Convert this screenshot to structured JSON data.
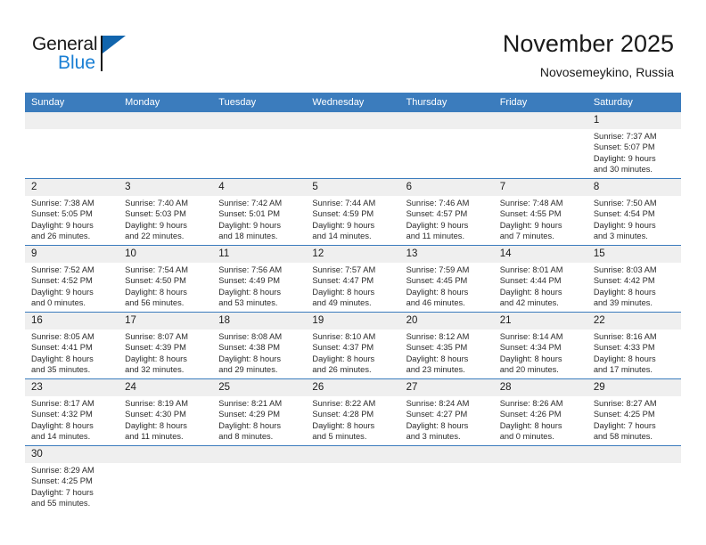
{
  "brand": {
    "name_top": "General",
    "name_bottom": "Blue",
    "accent_color": "#1a7fd4",
    "flag_color": "#1165ad"
  },
  "header": {
    "title": "November 2025",
    "subtitle": "Novosemeykino, Russia"
  },
  "theme": {
    "header_blue": "#3b7cbd",
    "row_band_gray": "#efefef",
    "divider_blue": "#3b7cbd"
  },
  "weekdays": [
    "Sunday",
    "Monday",
    "Tuesday",
    "Wednesday",
    "Thursday",
    "Friday",
    "Saturday"
  ],
  "weeks": [
    [
      {
        "day": "",
        "lines": []
      },
      {
        "day": "",
        "lines": []
      },
      {
        "day": "",
        "lines": []
      },
      {
        "day": "",
        "lines": []
      },
      {
        "day": "",
        "lines": []
      },
      {
        "day": "",
        "lines": []
      },
      {
        "day": "1",
        "lines": [
          "Sunrise: 7:37 AM",
          "Sunset: 5:07 PM",
          "Daylight: 9 hours",
          "and 30 minutes."
        ]
      }
    ],
    [
      {
        "day": "2",
        "lines": [
          "Sunrise: 7:38 AM",
          "Sunset: 5:05 PM",
          "Daylight: 9 hours",
          "and 26 minutes."
        ]
      },
      {
        "day": "3",
        "lines": [
          "Sunrise: 7:40 AM",
          "Sunset: 5:03 PM",
          "Daylight: 9 hours",
          "and 22 minutes."
        ]
      },
      {
        "day": "4",
        "lines": [
          "Sunrise: 7:42 AM",
          "Sunset: 5:01 PM",
          "Daylight: 9 hours",
          "and 18 minutes."
        ]
      },
      {
        "day": "5",
        "lines": [
          "Sunrise: 7:44 AM",
          "Sunset: 4:59 PM",
          "Daylight: 9 hours",
          "and 14 minutes."
        ]
      },
      {
        "day": "6",
        "lines": [
          "Sunrise: 7:46 AM",
          "Sunset: 4:57 PM",
          "Daylight: 9 hours",
          "and 11 minutes."
        ]
      },
      {
        "day": "7",
        "lines": [
          "Sunrise: 7:48 AM",
          "Sunset: 4:55 PM",
          "Daylight: 9 hours",
          "and 7 minutes."
        ]
      },
      {
        "day": "8",
        "lines": [
          "Sunrise: 7:50 AM",
          "Sunset: 4:54 PM",
          "Daylight: 9 hours",
          "and 3 minutes."
        ]
      }
    ],
    [
      {
        "day": "9",
        "lines": [
          "Sunrise: 7:52 AM",
          "Sunset: 4:52 PM",
          "Daylight: 9 hours",
          "and 0 minutes."
        ]
      },
      {
        "day": "10",
        "lines": [
          "Sunrise: 7:54 AM",
          "Sunset: 4:50 PM",
          "Daylight: 8 hours",
          "and 56 minutes."
        ]
      },
      {
        "day": "11",
        "lines": [
          "Sunrise: 7:56 AM",
          "Sunset: 4:49 PM",
          "Daylight: 8 hours",
          "and 53 minutes."
        ]
      },
      {
        "day": "12",
        "lines": [
          "Sunrise: 7:57 AM",
          "Sunset: 4:47 PM",
          "Daylight: 8 hours",
          "and 49 minutes."
        ]
      },
      {
        "day": "13",
        "lines": [
          "Sunrise: 7:59 AM",
          "Sunset: 4:45 PM",
          "Daylight: 8 hours",
          "and 46 minutes."
        ]
      },
      {
        "day": "14",
        "lines": [
          "Sunrise: 8:01 AM",
          "Sunset: 4:44 PM",
          "Daylight: 8 hours",
          "and 42 minutes."
        ]
      },
      {
        "day": "15",
        "lines": [
          "Sunrise: 8:03 AM",
          "Sunset: 4:42 PM",
          "Daylight: 8 hours",
          "and 39 minutes."
        ]
      }
    ],
    [
      {
        "day": "16",
        "lines": [
          "Sunrise: 8:05 AM",
          "Sunset: 4:41 PM",
          "Daylight: 8 hours",
          "and 35 minutes."
        ]
      },
      {
        "day": "17",
        "lines": [
          "Sunrise: 8:07 AM",
          "Sunset: 4:39 PM",
          "Daylight: 8 hours",
          "and 32 minutes."
        ]
      },
      {
        "day": "18",
        "lines": [
          "Sunrise: 8:08 AM",
          "Sunset: 4:38 PM",
          "Daylight: 8 hours",
          "and 29 minutes."
        ]
      },
      {
        "day": "19",
        "lines": [
          "Sunrise: 8:10 AM",
          "Sunset: 4:37 PM",
          "Daylight: 8 hours",
          "and 26 minutes."
        ]
      },
      {
        "day": "20",
        "lines": [
          "Sunrise: 8:12 AM",
          "Sunset: 4:35 PM",
          "Daylight: 8 hours",
          "and 23 minutes."
        ]
      },
      {
        "day": "21",
        "lines": [
          "Sunrise: 8:14 AM",
          "Sunset: 4:34 PM",
          "Daylight: 8 hours",
          "and 20 minutes."
        ]
      },
      {
        "day": "22",
        "lines": [
          "Sunrise: 8:16 AM",
          "Sunset: 4:33 PM",
          "Daylight: 8 hours",
          "and 17 minutes."
        ]
      }
    ],
    [
      {
        "day": "23",
        "lines": [
          "Sunrise: 8:17 AM",
          "Sunset: 4:32 PM",
          "Daylight: 8 hours",
          "and 14 minutes."
        ]
      },
      {
        "day": "24",
        "lines": [
          "Sunrise: 8:19 AM",
          "Sunset: 4:30 PM",
          "Daylight: 8 hours",
          "and 11 minutes."
        ]
      },
      {
        "day": "25",
        "lines": [
          "Sunrise: 8:21 AM",
          "Sunset: 4:29 PM",
          "Daylight: 8 hours",
          "and 8 minutes."
        ]
      },
      {
        "day": "26",
        "lines": [
          "Sunrise: 8:22 AM",
          "Sunset: 4:28 PM",
          "Daylight: 8 hours",
          "and 5 minutes."
        ]
      },
      {
        "day": "27",
        "lines": [
          "Sunrise: 8:24 AM",
          "Sunset: 4:27 PM",
          "Daylight: 8 hours",
          "and 3 minutes."
        ]
      },
      {
        "day": "28",
        "lines": [
          "Sunrise: 8:26 AM",
          "Sunset: 4:26 PM",
          "Daylight: 8 hours",
          "and 0 minutes."
        ]
      },
      {
        "day": "29",
        "lines": [
          "Sunrise: 8:27 AM",
          "Sunset: 4:25 PM",
          "Daylight: 7 hours",
          "and 58 minutes."
        ]
      }
    ],
    [
      {
        "day": "30",
        "lines": [
          "Sunrise: 8:29 AM",
          "Sunset: 4:25 PM",
          "Daylight: 7 hours",
          "and 55 minutes."
        ]
      },
      {
        "day": "",
        "lines": []
      },
      {
        "day": "",
        "lines": []
      },
      {
        "day": "",
        "lines": []
      },
      {
        "day": "",
        "lines": []
      },
      {
        "day": "",
        "lines": []
      },
      {
        "day": "",
        "lines": []
      }
    ]
  ]
}
